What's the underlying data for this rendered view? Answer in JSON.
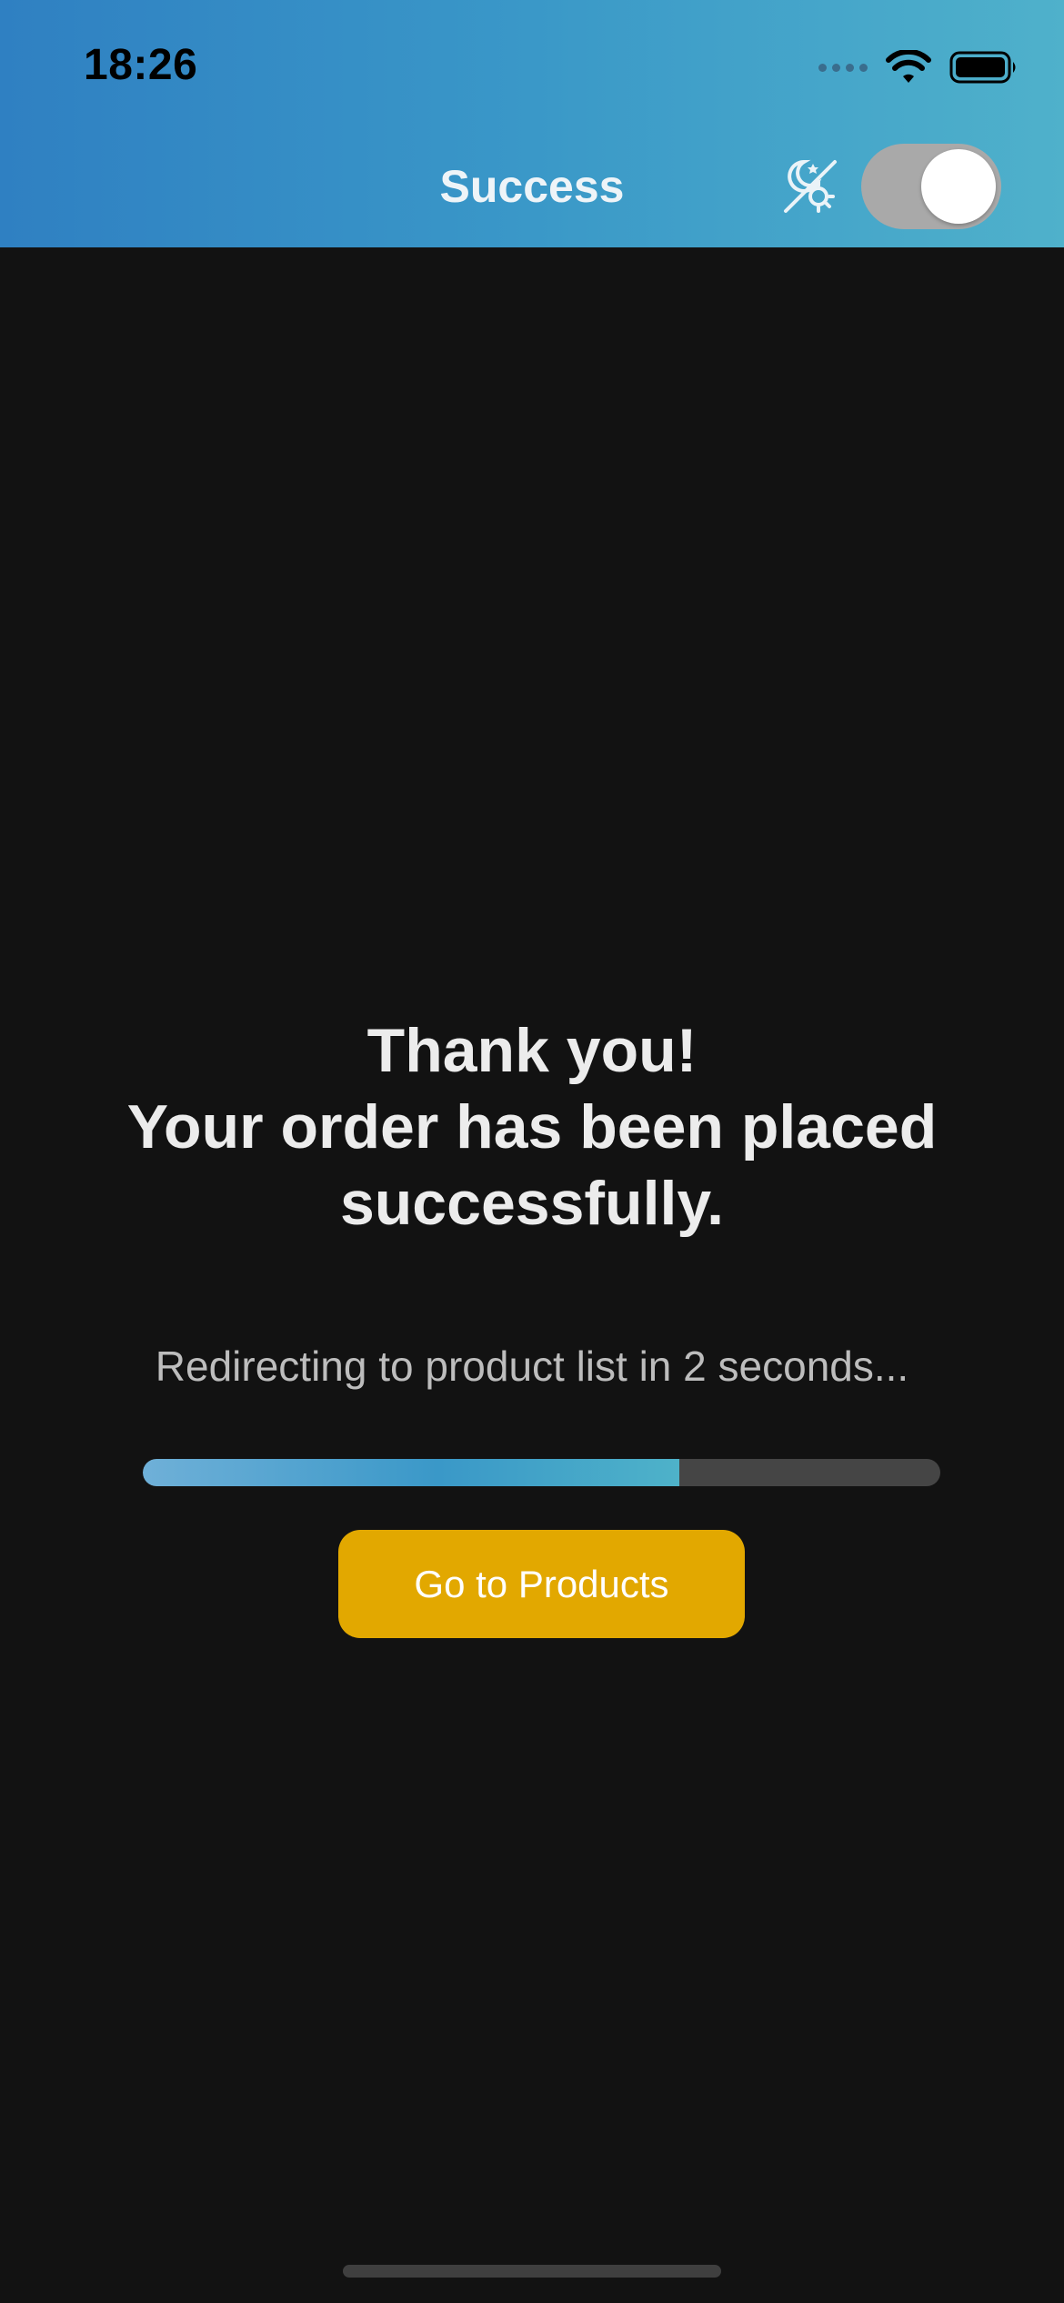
{
  "status_bar": {
    "time": "18:26",
    "icons": [
      "cellular-signal-icon",
      "wifi-icon",
      "battery-icon"
    ]
  },
  "header": {
    "title": "Success",
    "theme_icon": "moon-sun-theme-icon",
    "theme_toggle_on": true
  },
  "message": {
    "line1": "Thank you!",
    "line2": "Your order has been placed",
    "line3": "successfully."
  },
  "redirect": {
    "text": "Redirecting to product list in 2 seconds..."
  },
  "progress": {
    "fraction": 0.673
  },
  "actions": {
    "go_to_products_label": "Go to Products"
  },
  "colors": {
    "header_gradient_start": "#2f80c2",
    "header_gradient_end": "#4fb1cb",
    "background": "#121212",
    "button": "#e2a800",
    "progress_track": "#454545",
    "progress_fill": "#3a98c8"
  }
}
